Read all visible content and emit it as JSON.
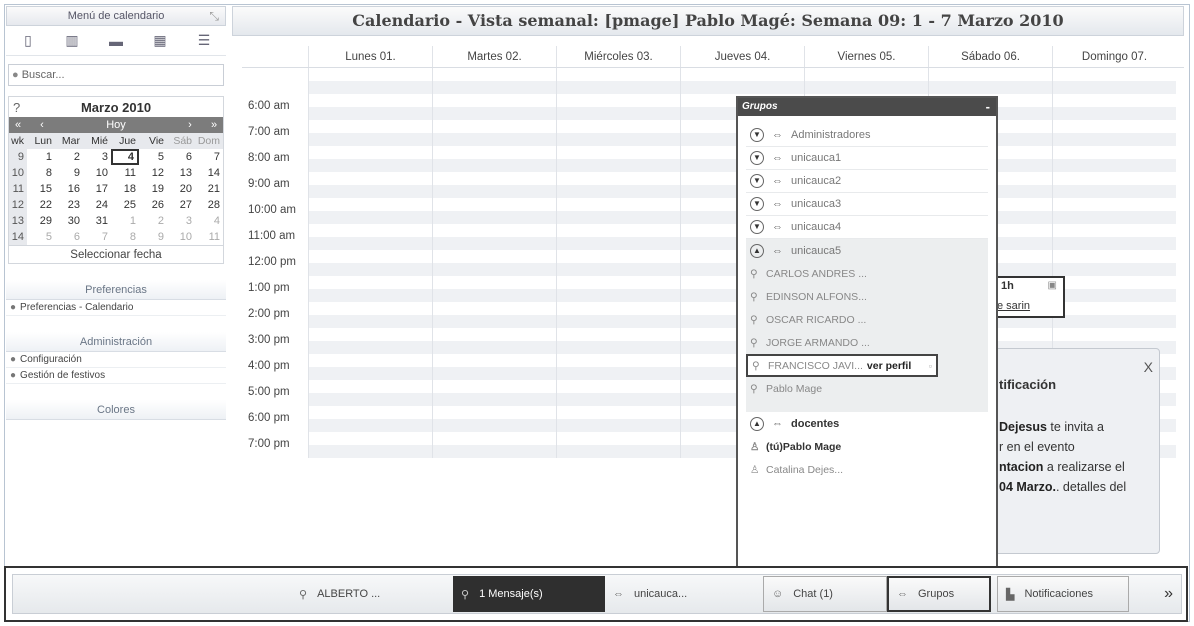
{
  "sidebar": {
    "header": "Menú de calendario",
    "search_placeholder": "Buscar...",
    "calendar": {
      "help": "?",
      "title": "Marzo 2010",
      "nav": [
        "«",
        "‹",
        "Hoy",
        "›",
        "»"
      ],
      "headers": [
        "wk",
        "Lun",
        "Mar",
        "Mié",
        "Jue",
        "Vie",
        "Sáb",
        "Dom"
      ],
      "weeks": [
        {
          "wk": "9",
          "days": [
            "1",
            "2",
            "3",
            "4",
            "5",
            "6",
            "7"
          ]
        },
        {
          "wk": "10",
          "days": [
            "8",
            "9",
            "10",
            "11",
            "12",
            "13",
            "14"
          ]
        },
        {
          "wk": "11",
          "days": [
            "15",
            "16",
            "17",
            "18",
            "19",
            "20",
            "21"
          ]
        },
        {
          "wk": "12",
          "days": [
            "22",
            "23",
            "24",
            "25",
            "26",
            "27",
            "28"
          ]
        },
        {
          "wk": "13",
          "days": [
            "29",
            "30",
            "31",
            "1",
            "2",
            "3",
            "4"
          ]
        },
        {
          "wk": "14",
          "days": [
            "5",
            "6",
            "7",
            "8",
            "9",
            "10",
            "11"
          ]
        }
      ],
      "select_date": "Seleccionar fecha"
    },
    "preferences": {
      "title": "Preferencias",
      "items": [
        "Preferencias - Calendario"
      ]
    },
    "admin": {
      "title": "Administración",
      "items": [
        "Configuración",
        "Gestión de festivos"
      ]
    },
    "colors": {
      "title": "Colores"
    }
  },
  "main": {
    "title": "Calendario - Vista semanal: [pmage] Pablo Magé: Semana 09: 1 - 7 Marzo 2010",
    "days": [
      "Lunes 01.",
      "Martes 02.",
      "Miércoles 03.",
      "Jueves 04.",
      "Viernes 05.",
      "Sábado 06.",
      "Domingo 07."
    ],
    "times": [
      "",
      "6:00 am",
      "7:00 am",
      "8:00 am",
      "9:00 am",
      "10:00 am",
      "11:00 am",
      "12:00 pm",
      "1:00 pm",
      "2:00 pm",
      "3:00 pm",
      "4:00 pm",
      "5:00 pm",
      "6:00 pm",
      "7:00 pm"
    ]
  },
  "event": {
    "duration": "1h",
    "title": "e sarin"
  },
  "notification": {
    "close": "X",
    "heading": "tificación",
    "line1_bold": "Dejesus",
    "line1_rest": " te invita a",
    "line2": "r en el evento",
    "line3_bold": "ntacion",
    "line3_rest": " a realizarse el",
    "line4_bold": "04 Marzo.",
    "line4_rest": ". detalles del"
  },
  "groups_popup": {
    "title": "Grupos",
    "minimize": "-",
    "groups": [
      "Administradores",
      "unicauca1",
      "unicauca2",
      "unicauca3",
      "unicauca4"
    ],
    "expanded_group": "unicauca5",
    "members": [
      "CARLOS ANDRES ...",
      "EDINSON ALFONS...",
      "OSCAR RICARDO ...",
      "JORGE ARMANDO ..."
    ],
    "highlight_member": "FRANCISCO JAVI...",
    "highlight_action": "ver perfil",
    "last_member": "Pablo Mage",
    "group2": "docentes",
    "group2_members": [
      "(tú)Pablo Mage",
      "Catalina Dejes..."
    ]
  },
  "bottom_bar": {
    "chat_user": "ALBERTO ...",
    "messages": "1 Mensaje(s)",
    "group_chat": "unicauca...",
    "chat": "Chat (1)",
    "groups": "Grupos",
    "notifications": "Notificaciones",
    "more": "»"
  }
}
